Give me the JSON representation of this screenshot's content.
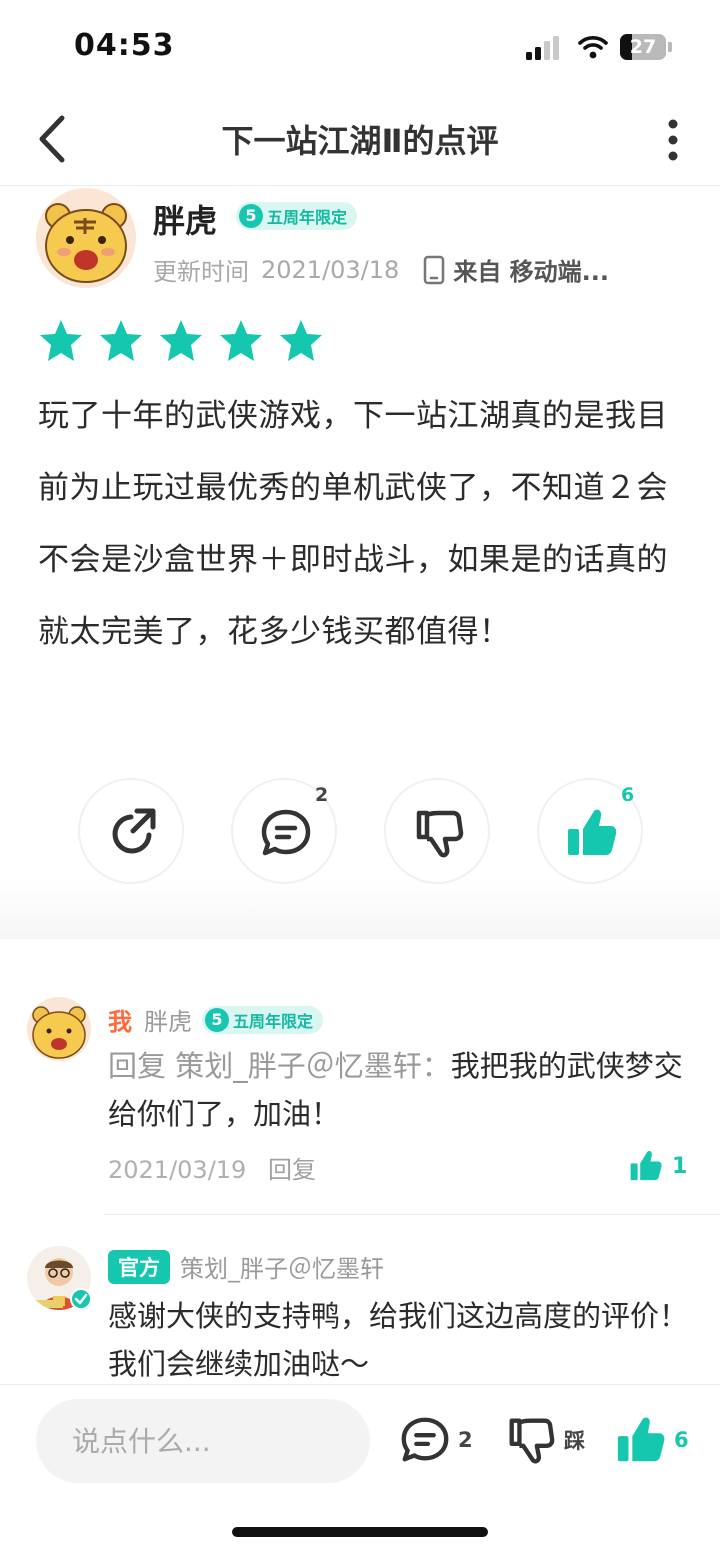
{
  "status_bar": {
    "time": "04:53",
    "battery_level": "27",
    "battery_fraction": 0.27
  },
  "nav": {
    "title": "下一站江湖Ⅱ的点评"
  },
  "review": {
    "author": "胖虎",
    "badge_number": "5",
    "badge_text": "五周年限定",
    "updated_label": "更新时间",
    "updated_date": "2021/03/18",
    "source": "来自 移动端...",
    "rating": 5,
    "rating_max": 5,
    "text": "玩了十年的武侠游戏，下一站江湖真的是我目前为止玩过最优秀的单机武侠了，不知道２会不会是沙盒世界＋即时战斗，如果是的话真的就太完美了，花多少钱买都值得！",
    "comment_count": "2",
    "like_count": "6"
  },
  "replies": [
    {
      "me_tag": "我",
      "author": "胖虎",
      "badge_number": "5",
      "badge_text": "五周年限定",
      "reply_prefix": "回复 策划_胖子＠忆墨轩：",
      "text": "我把我的武侠梦交给你们了，加油！",
      "date": "2021/03/19",
      "reply_label": "回复",
      "like_count": "1"
    },
    {
      "official_tag": "官方",
      "author": "策划_胖子＠忆墨轩",
      "text": "感谢大侠的支持鸭，给我们这边高度的评价！我们会继续加油哒～"
    }
  ],
  "bottom_bar": {
    "input_placeholder": "说点什么...",
    "comment_count": "2",
    "dislike_label": "踩",
    "like_count": "6"
  },
  "colors": {
    "accent": "#14c7ae",
    "me_tag": "#ff6a3d",
    "muted": "#9a9a9a"
  },
  "icons": [
    "back-icon",
    "more-icon",
    "device-icon",
    "star-icon",
    "share-icon",
    "comment-icon",
    "dislike-icon",
    "like-icon",
    "verified-icon"
  ]
}
